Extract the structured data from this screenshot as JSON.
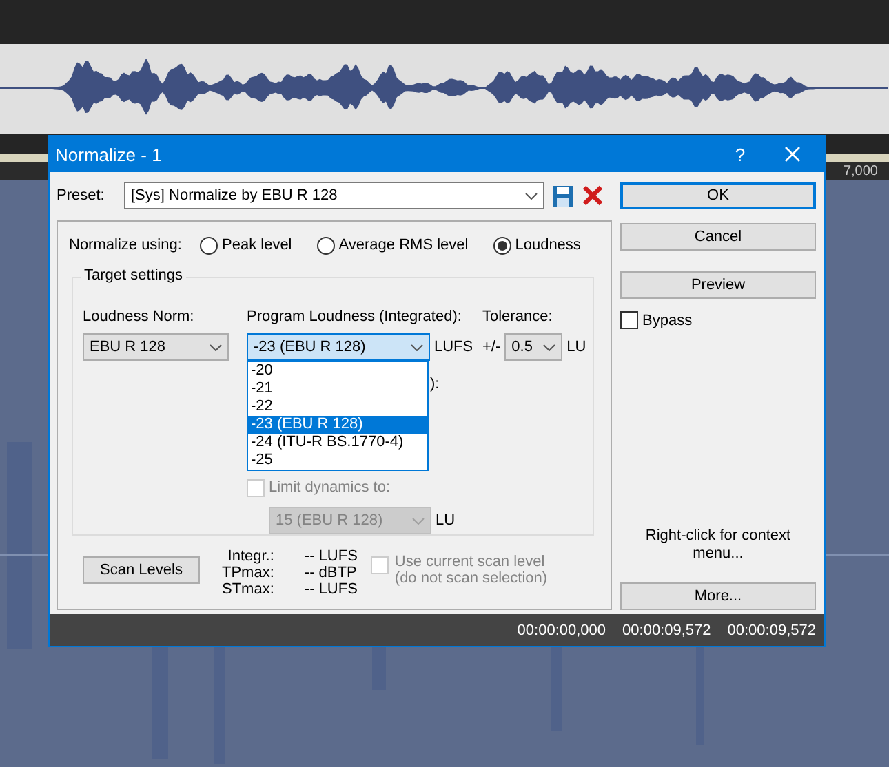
{
  "ruler_label": "7,000",
  "window": {
    "title": "Normalize - 1",
    "help": "?"
  },
  "preset": {
    "label": "Preset:",
    "value": "[Sys] Normalize by EBU R 128"
  },
  "normalize_using": {
    "label": "Normalize using:",
    "options": [
      {
        "label": "Peak level",
        "selected": false
      },
      {
        "label": "Average RMS level",
        "selected": false
      },
      {
        "label": "Loudness",
        "selected": true
      }
    ]
  },
  "target_settings": {
    "title": "Target settings",
    "loudness_norm": {
      "label": "Loudness Norm:",
      "value": "EBU R 128"
    },
    "program_loudness": {
      "label": "Program Loudness (Integrated):",
      "value": "-23 (EBU R 128)",
      "unit": "LUFS",
      "expanded": true,
      "options": [
        {
          "label": "-20",
          "selected": false
        },
        {
          "label": "-21",
          "selected": false
        },
        {
          "label": "-22",
          "selected": false
        },
        {
          "label": "-23 (EBU R 128)",
          "selected": true
        },
        {
          "label": "-24 (ITU-R BS.1770-4)",
          "selected": false
        },
        {
          "label": "-25",
          "selected": false
        }
      ]
    },
    "tolerance": {
      "label": "Tolerance:",
      "prefix": "+/-",
      "value": "0.5",
      "unit": "LU"
    },
    "covered_label_tail": "):",
    "limit_dynamics": {
      "label": "Limit dynamics to:",
      "checked": false,
      "disabled": true,
      "value": "15 (EBU R 128)",
      "unit": "LU"
    }
  },
  "scan": {
    "button": "Scan Levels",
    "stats": [
      {
        "label": "Integr.:",
        "value": "-- LUFS"
      },
      {
        "label": "TPmax:",
        "value": "-- dBTP"
      },
      {
        "label": "STmax:",
        "value": "-- LUFS"
      }
    ],
    "use_current": {
      "lines": [
        "Use current scan level",
        "(do not scan selection)"
      ],
      "checked": false,
      "disabled": true
    }
  },
  "buttons": [
    {
      "label": "OK",
      "default": true
    },
    {
      "label": "Cancel",
      "default": false
    },
    {
      "label": "Preview",
      "default": false
    }
  ],
  "bypass": {
    "label": "Bypass",
    "checked": false
  },
  "hint": "Right-click for context menu...",
  "more_button": "More...",
  "status_bar": {
    "times": [
      "00:00:00,000",
      "00:00:09,572",
      "00:00:09,572"
    ]
  }
}
